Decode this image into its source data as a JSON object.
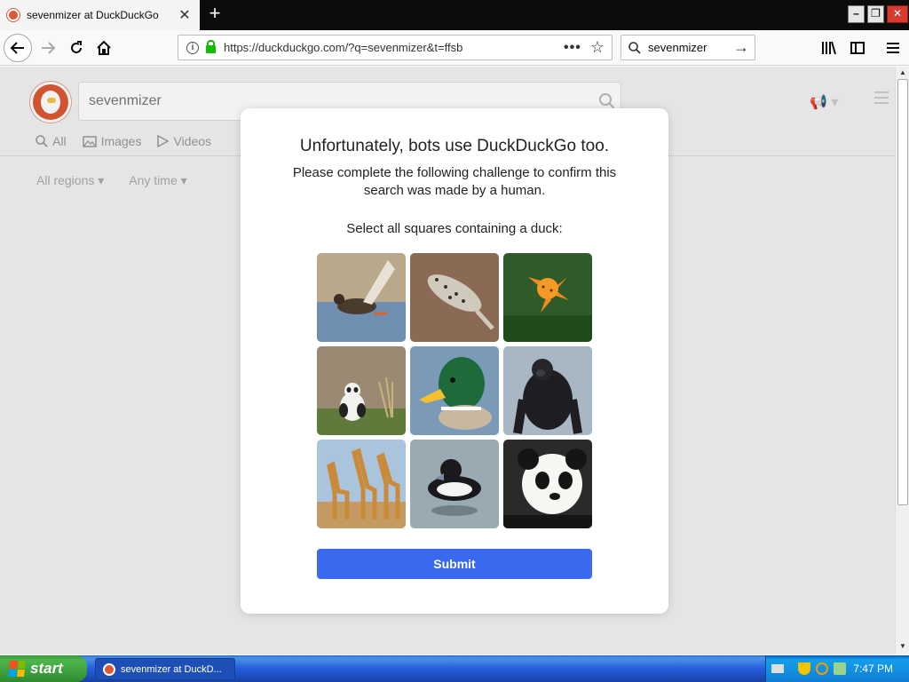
{
  "browser": {
    "tab_title": "sevenmizer at DuckDuckGo",
    "tab_close": "✕",
    "new_tab": "+",
    "url": "https://duckduckgo.com/?q=sevenmizer&t=ffsb",
    "url_dots": "•••",
    "star": "☆",
    "search_value": "sevenmizer",
    "search_go": "→"
  },
  "page": {
    "query": "sevenmizer",
    "tabs": [
      {
        "label": "All",
        "icon": "search-icon"
      },
      {
        "label": "Images",
        "icon": "image-icon"
      },
      {
        "label": "Videos",
        "icon": "video-icon"
      }
    ],
    "filters": {
      "region": "All regions ▾",
      "time": "Any time ▾"
    }
  },
  "modal": {
    "title": "Unfortunately, bots use DuckDuckGo too.",
    "subtitle": "Please complete the following challenge to confirm this search was made by a human.",
    "instruction": "Select all squares containing a duck:",
    "tiles": [
      {
        "subject": "duck-flying"
      },
      {
        "subject": "leopard-gecko"
      },
      {
        "subject": "tiger-lily"
      },
      {
        "subject": "panda-grass"
      },
      {
        "subject": "mallard-duck"
      },
      {
        "subject": "gorilla"
      },
      {
        "subject": "giraffes"
      },
      {
        "subject": "tufted-duck"
      },
      {
        "subject": "panda-face"
      }
    ],
    "submit": "Submit"
  },
  "taskbar": {
    "start": "start",
    "window_item": "sevenmizer at DuckD...",
    "clock": "7:47 PM"
  },
  "colors": {
    "accent": "#3969ef",
    "ddg": "#de5833",
    "xp_blue": "#245edb",
    "xp_green": "#3c9a3c"
  }
}
